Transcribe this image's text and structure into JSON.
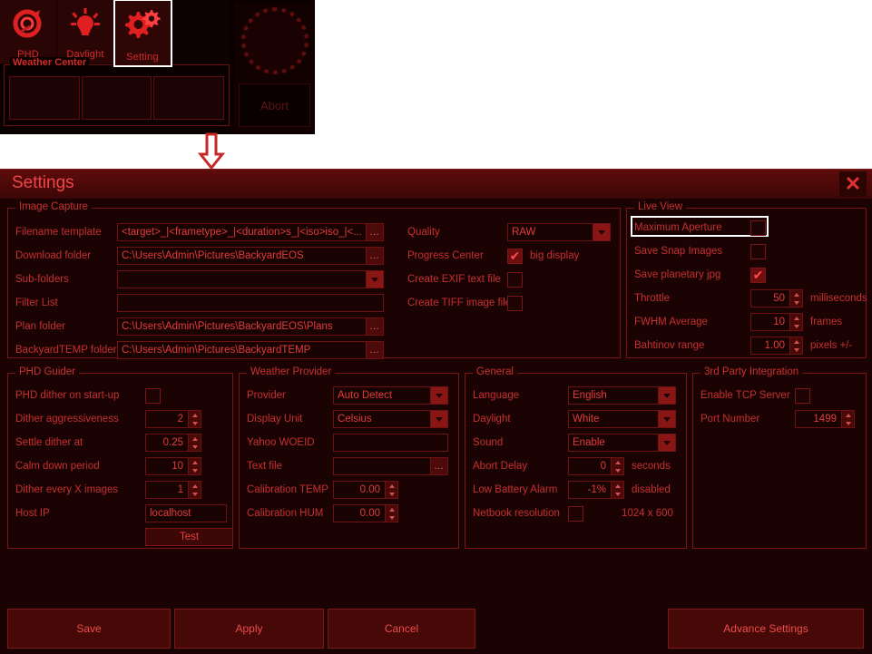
{
  "toolbar": {
    "buttons": [
      {
        "label": "PHD",
        "icon": "phd-guiding-icon",
        "selected": false
      },
      {
        "label": "Daylight",
        "icon": "lightbulb-icon",
        "selected": false
      },
      {
        "label": "Setting",
        "icon": "gears-icon",
        "selected": true
      },
      {
        "label": "",
        "icon": "blank-icon",
        "selected": false
      }
    ],
    "weather_center": {
      "title": "Weather Center",
      "cells": [
        "",
        "",
        ""
      ]
    },
    "abort_label": "Abort",
    "dial_name": "focus-dial"
  },
  "dialog": {
    "title": "Settings",
    "close_label": "✕"
  },
  "image_capture": {
    "title": "Image Capture",
    "rows": [
      {
        "label": "Filename template",
        "value": "<target>_|<frametype>_|<duration>s_|<iso>iso_|<...",
        "control": "browse"
      },
      {
        "label": "Download folder",
        "value": "C:\\Users\\Admin\\Pictures\\BackyardEOS",
        "control": "browse"
      },
      {
        "label": "Sub-folders",
        "value": "",
        "control": "dropdown"
      },
      {
        "label": "Filter List",
        "value": "",
        "control": "none"
      },
      {
        "label": "Plan folder",
        "value": "C:\\Users\\Admin\\Pictures\\BackyardEOS\\Plans",
        "control": "browse"
      },
      {
        "label": "BackyardTEMP folder",
        "value": "C:\\Users\\Admin\\Pictures\\BackyardTEMP",
        "control": "browse"
      }
    ],
    "browse_label": "…",
    "quality": {
      "label": "Quality",
      "value": "RAW"
    },
    "progress_center": {
      "label": "Progress Center",
      "checked": true,
      "suffix": "big display"
    },
    "create_exif": {
      "label": "Create EXIF text file",
      "checked": false
    },
    "create_tiff": {
      "label": "Create TIFF image file",
      "checked": false
    }
  },
  "live_view": {
    "title": "Live View",
    "maximum_aperture": {
      "label": "Maximum Aperture",
      "checked": false,
      "focused": true
    },
    "save_snap": {
      "label": "Save Snap Images",
      "checked": false
    },
    "save_planetary": {
      "label": "Save planetary jpg",
      "checked": true
    },
    "throttle": {
      "label": "Throttle",
      "value": "50",
      "unit": "milliseconds"
    },
    "fwhm": {
      "label": "FWHM Average",
      "value": "10",
      "unit": "frames"
    },
    "bahtinov": {
      "label": "Bahtinov range",
      "value": "1.00",
      "unit": "pixels +/-"
    }
  },
  "phd_guider": {
    "title": "PHD Guider",
    "dither_on_startup": {
      "label": "PHD dither on start-up",
      "checked": false
    },
    "aggressiveness": {
      "label": "Dither aggressiveness",
      "value": "2"
    },
    "settle_dither": {
      "label": "Settle dither at",
      "value": "0.25"
    },
    "calm_down": {
      "label": "Calm down period",
      "value": "10"
    },
    "dither_every": {
      "label": "Dither every X images",
      "value": "1"
    },
    "host_ip": {
      "label": "Host IP",
      "value": "localhost"
    },
    "test_label": "Test"
  },
  "weather_provider": {
    "title": "Weather Provider",
    "provider": {
      "label": "Provider",
      "value": "Auto Detect"
    },
    "display_unit": {
      "label": "Display Unit",
      "value": "Celsius"
    },
    "yahoo_woeid": {
      "label": "Yahoo WOEID",
      "value": ""
    },
    "text_file": {
      "label": "Text file",
      "value": ""
    },
    "cal_temp": {
      "label": "Calibration TEMP",
      "value": "0.00"
    },
    "cal_hum": {
      "label": "Calibration HUM",
      "value": "0.00"
    },
    "browse_label": "…"
  },
  "general": {
    "title": "General",
    "language": {
      "label": "Language",
      "value": "English"
    },
    "daylight": {
      "label": "Daylight",
      "value": "White"
    },
    "sound": {
      "label": "Sound",
      "value": "Enable"
    },
    "abort_delay": {
      "label": "Abort Delay",
      "value": "0",
      "unit": "seconds"
    },
    "low_battery": {
      "label": "Low Battery Alarm",
      "value": "-1%",
      "unit": "disabled"
    },
    "netbook": {
      "label": "Netbook resolution",
      "checked": false,
      "unit": "1024 x 600"
    }
  },
  "third_party": {
    "title": "3rd Party Integration",
    "tcp_server": {
      "label": "Enable TCP Server",
      "checked": false
    },
    "port_number": {
      "label": "Port Number",
      "value": "1499"
    }
  },
  "footer": {
    "save": "Save",
    "apply": "Apply",
    "cancel": "Cancel",
    "advance": "Advance Settings"
  },
  "colors": {
    "accent": "#d42b2b",
    "bg": "#1b0303",
    "field_bg": "#190202",
    "border": "#7a1414",
    "focus": "#ffffff"
  }
}
